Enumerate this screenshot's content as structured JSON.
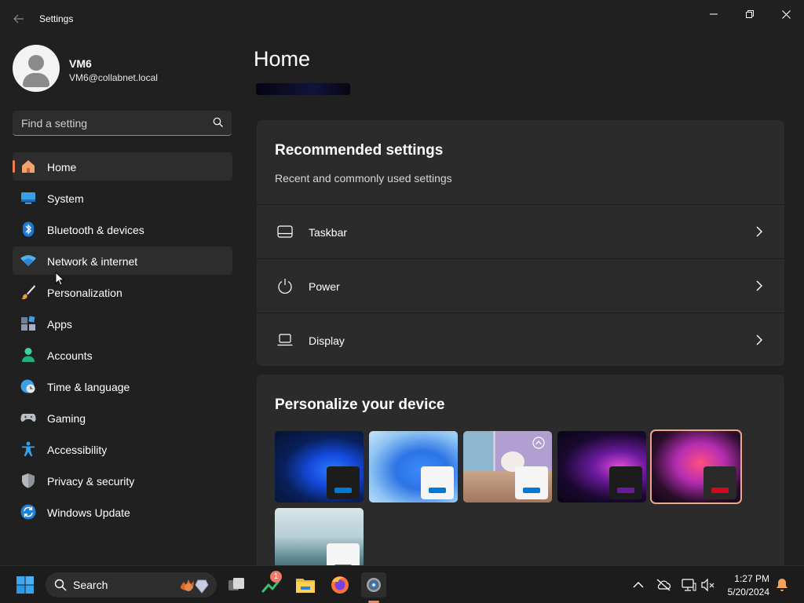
{
  "window": {
    "title": "Settings",
    "back_icon": "arrow-left-icon",
    "minimize_icon": "minimize-icon",
    "maximize_icon": "restore-icon",
    "close_icon": "close-icon"
  },
  "profile": {
    "name": "VM6",
    "email": "VM6@collabnet.local",
    "avatar_icon": "user-avatar-icon"
  },
  "search": {
    "placeholder": "Find a setting",
    "value": "",
    "icon": "search-icon"
  },
  "sidebar": {
    "items": [
      {
        "label": "Home",
        "icon": "home-icon",
        "selected": true
      },
      {
        "label": "System",
        "icon": "monitor-icon"
      },
      {
        "label": "Bluetooth & devices",
        "icon": "bluetooth-icon"
      },
      {
        "label": "Network & internet",
        "icon": "wifi-icon",
        "hovered": true
      },
      {
        "label": "Personalization",
        "icon": "paintbrush-icon"
      },
      {
        "label": "Apps",
        "icon": "apps-icon"
      },
      {
        "label": "Accounts",
        "icon": "person-icon"
      },
      {
        "label": "Time & language",
        "icon": "globe-clock-icon"
      },
      {
        "label": "Gaming",
        "icon": "gamepad-icon"
      },
      {
        "label": "Accessibility",
        "icon": "accessibility-icon"
      },
      {
        "label": "Privacy & security",
        "icon": "shield-icon"
      },
      {
        "label": "Windows Update",
        "icon": "update-icon"
      }
    ]
  },
  "main": {
    "page_title": "Home",
    "recommended": {
      "title": "Recommended settings",
      "subtitle": "Recent and commonly used settings",
      "rows": [
        {
          "label": "Taskbar",
          "icon": "taskbar-icon"
        },
        {
          "label": "Power",
          "icon": "power-icon"
        },
        {
          "label": "Display",
          "icon": "laptop-icon"
        }
      ]
    },
    "personalize": {
      "title": "Personalize your device",
      "selected_theme_index": 4,
      "themes": [
        {
          "accent": "#0078d4"
        },
        {
          "accent": "#0078d4"
        },
        {
          "accent": "#0078d4"
        },
        {
          "accent": "#6b1a9e"
        },
        {
          "accent": "#d10a1e"
        },
        {
          "accent": "#0078d4"
        }
      ]
    }
  },
  "taskbar": {
    "search_label": "Search",
    "notification_badge": "1",
    "clock_time": "1:27 PM",
    "clock_date": "5/20/2024",
    "icons": [
      "windows-start-icon",
      "search-icon",
      "task-view-icon",
      "stocks-icon",
      "file-explorer-icon",
      "firefox-icon",
      "settings-gear-icon"
    ],
    "tray_icons": [
      "chevron-up-icon",
      "cloud-off-icon",
      "network-icon",
      "volume-muted-icon",
      "bell-icon"
    ]
  },
  "colors": {
    "accent": "#f47a4b",
    "background": "#202020",
    "card": "#2b2b2b"
  }
}
